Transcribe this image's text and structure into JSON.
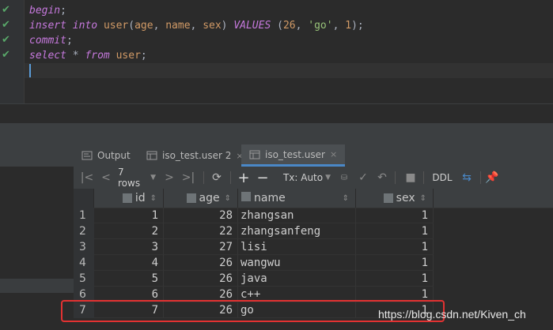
{
  "editor": {
    "lines": [
      {
        "parts": [
          {
            "t": "begin",
            "c": "kwi"
          },
          {
            "t": ";",
            "c": "plain"
          }
        ]
      },
      {
        "parts": [
          {
            "t": "insert",
            "c": "kwi"
          },
          {
            "t": " ",
            "c": "plain"
          },
          {
            "t": "into",
            "c": "kwi"
          },
          {
            "t": " ",
            "c": "plain"
          },
          {
            "t": "user",
            "c": "fn"
          },
          {
            "t": "(",
            "c": "plain"
          },
          {
            "t": "age",
            "c": "fn"
          },
          {
            "t": ", ",
            "c": "plain"
          },
          {
            "t": "name",
            "c": "fn"
          },
          {
            "t": ", ",
            "c": "plain"
          },
          {
            "t": "sex",
            "c": "fn"
          },
          {
            "t": ") ",
            "c": "plain"
          },
          {
            "t": "VALUES",
            "c": "kwi"
          },
          {
            "t": " (",
            "c": "plain"
          },
          {
            "t": "26",
            "c": "num"
          },
          {
            "t": ", ",
            "c": "plain"
          },
          {
            "t": "'go'",
            "c": "str"
          },
          {
            "t": ", ",
            "c": "plain"
          },
          {
            "t": "1",
            "c": "num"
          },
          {
            "t": ");",
            "c": "plain"
          }
        ]
      },
      {
        "parts": [
          {
            "t": "commit",
            "c": "kwi"
          },
          {
            "t": ";",
            "c": "plain"
          }
        ]
      },
      {
        "parts": [
          {
            "t": "select",
            "c": "kwi"
          },
          {
            "t": " * ",
            "c": "plain"
          },
          {
            "t": "from",
            "c": "kwi"
          },
          {
            "t": " ",
            "c": "plain"
          },
          {
            "t": "user",
            "c": "fn"
          },
          {
            "t": ";",
            "c": "plain"
          }
        ]
      }
    ]
  },
  "tabs": [
    {
      "label": "Output",
      "icon": "output-icon",
      "close": ""
    },
    {
      "label": "iso_test.user 2",
      "icon": "table-icon",
      "close": "×"
    },
    {
      "label": "iso_test.user",
      "icon": "table-icon",
      "close": "×"
    }
  ],
  "toolbar": {
    "rows_label": "7 rows",
    "tx_label": "Tx: Auto",
    "ddl_label": "DDL"
  },
  "grid": {
    "columns": [
      {
        "label": "id",
        "align": "r"
      },
      {
        "label": "age",
        "align": "r"
      },
      {
        "label": "name",
        "align": "l"
      },
      {
        "label": "sex",
        "align": "r"
      }
    ],
    "rows": [
      {
        "n": "1",
        "cells": [
          "1",
          "28",
          "zhangsan",
          "1"
        ]
      },
      {
        "n": "2",
        "cells": [
          "2",
          "22",
          "zhangsanfeng",
          "1"
        ]
      },
      {
        "n": "3",
        "cells": [
          "3",
          "27",
          "lisi",
          "1"
        ]
      },
      {
        "n": "4",
        "cells": [
          "4",
          "26",
          "wangwu",
          "1"
        ]
      },
      {
        "n": "5",
        "cells": [
          "5",
          "26",
          "java",
          "1"
        ]
      },
      {
        "n": "6",
        "cells": [
          "6",
          "26",
          "c++",
          "1"
        ]
      },
      {
        "n": "7",
        "cells": [
          "7",
          "26",
          "go",
          "1"
        ]
      }
    ]
  },
  "watermark": "https://blog.csdn.net/Kiven_ch",
  "colors": {
    "accent": "#4a88c7",
    "highlight_border": "#e23232",
    "check": "#59a869"
  }
}
